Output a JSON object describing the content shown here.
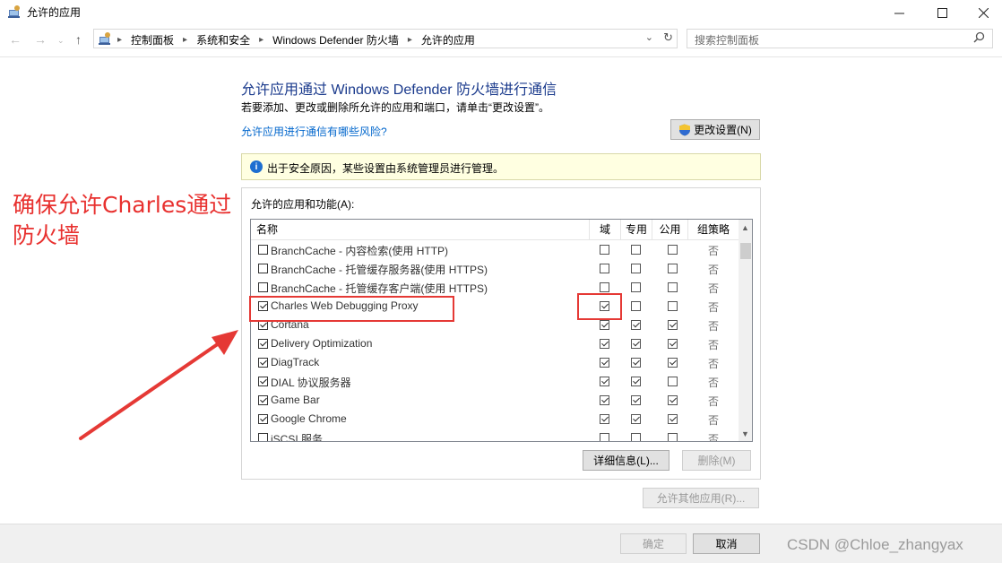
{
  "window": {
    "title": "允许的应用"
  },
  "address": {
    "crumbs": [
      "控制面板",
      "系统和安全",
      "Windows Defender 防火墙",
      "允许的应用"
    ],
    "search_placeholder": "搜索控制面板"
  },
  "content": {
    "heading": "允许应用通过 Windows Defender 防火墙进行通信",
    "description": "若要添加、更改或删除所允许的应用和端口，请单击“更改设置”。",
    "risk_link": "允许应用进行通信有哪些风险?",
    "change_settings": "更改设置(N)",
    "info_message": "出于安全原因，某些设置由系统管理员进行管理。",
    "group_label": "允许的应用和功能(A):"
  },
  "table": {
    "columns": [
      "名称",
      "域",
      "专用",
      "公用",
      "组策略"
    ],
    "rows": [
      {
        "name": "BranchCache - 内容检索(使用 HTTP)",
        "enabled": false,
        "domain": false,
        "private": false,
        "public": false,
        "gp": "否"
      },
      {
        "name": "BranchCache - 托管缓存服务器(使用 HTTPS)",
        "enabled": false,
        "domain": false,
        "private": false,
        "public": false,
        "gp": "否"
      },
      {
        "name": "BranchCache - 托管缓存客户端(使用 HTTPS)",
        "enabled": false,
        "domain": false,
        "private": false,
        "public": false,
        "gp": "否"
      },
      {
        "name": "Charles Web Debugging Proxy",
        "enabled": true,
        "domain": true,
        "private": false,
        "public": false,
        "gp": "否"
      },
      {
        "name": "Cortana",
        "enabled": true,
        "domain": true,
        "private": true,
        "public": true,
        "gp": "否"
      },
      {
        "name": "Delivery Optimization",
        "enabled": true,
        "domain": true,
        "private": true,
        "public": true,
        "gp": "否"
      },
      {
        "name": "DiagTrack",
        "enabled": true,
        "domain": true,
        "private": true,
        "public": true,
        "gp": "否"
      },
      {
        "name": "DIAL 协议服务器",
        "enabled": true,
        "domain": true,
        "private": true,
        "public": false,
        "gp": "否"
      },
      {
        "name": "Game Bar",
        "enabled": true,
        "domain": true,
        "private": true,
        "public": true,
        "gp": "否"
      },
      {
        "name": "Google Chrome",
        "enabled": true,
        "domain": true,
        "private": true,
        "public": true,
        "gp": "否"
      },
      {
        "name": "iSCSI 服务",
        "enabled": false,
        "domain": false,
        "private": false,
        "public": false,
        "gp": "否"
      }
    ]
  },
  "buttons": {
    "details": "详细信息(L)...",
    "remove": "删除(M)",
    "allow_other": "允许其他应用(R)...",
    "ok": "确定",
    "cancel": "取消"
  },
  "annotation": {
    "text": "确保允许Charles通过防火墙",
    "color": "#e53935"
  },
  "watermark": "CSDN @Chloe_zhangyax"
}
